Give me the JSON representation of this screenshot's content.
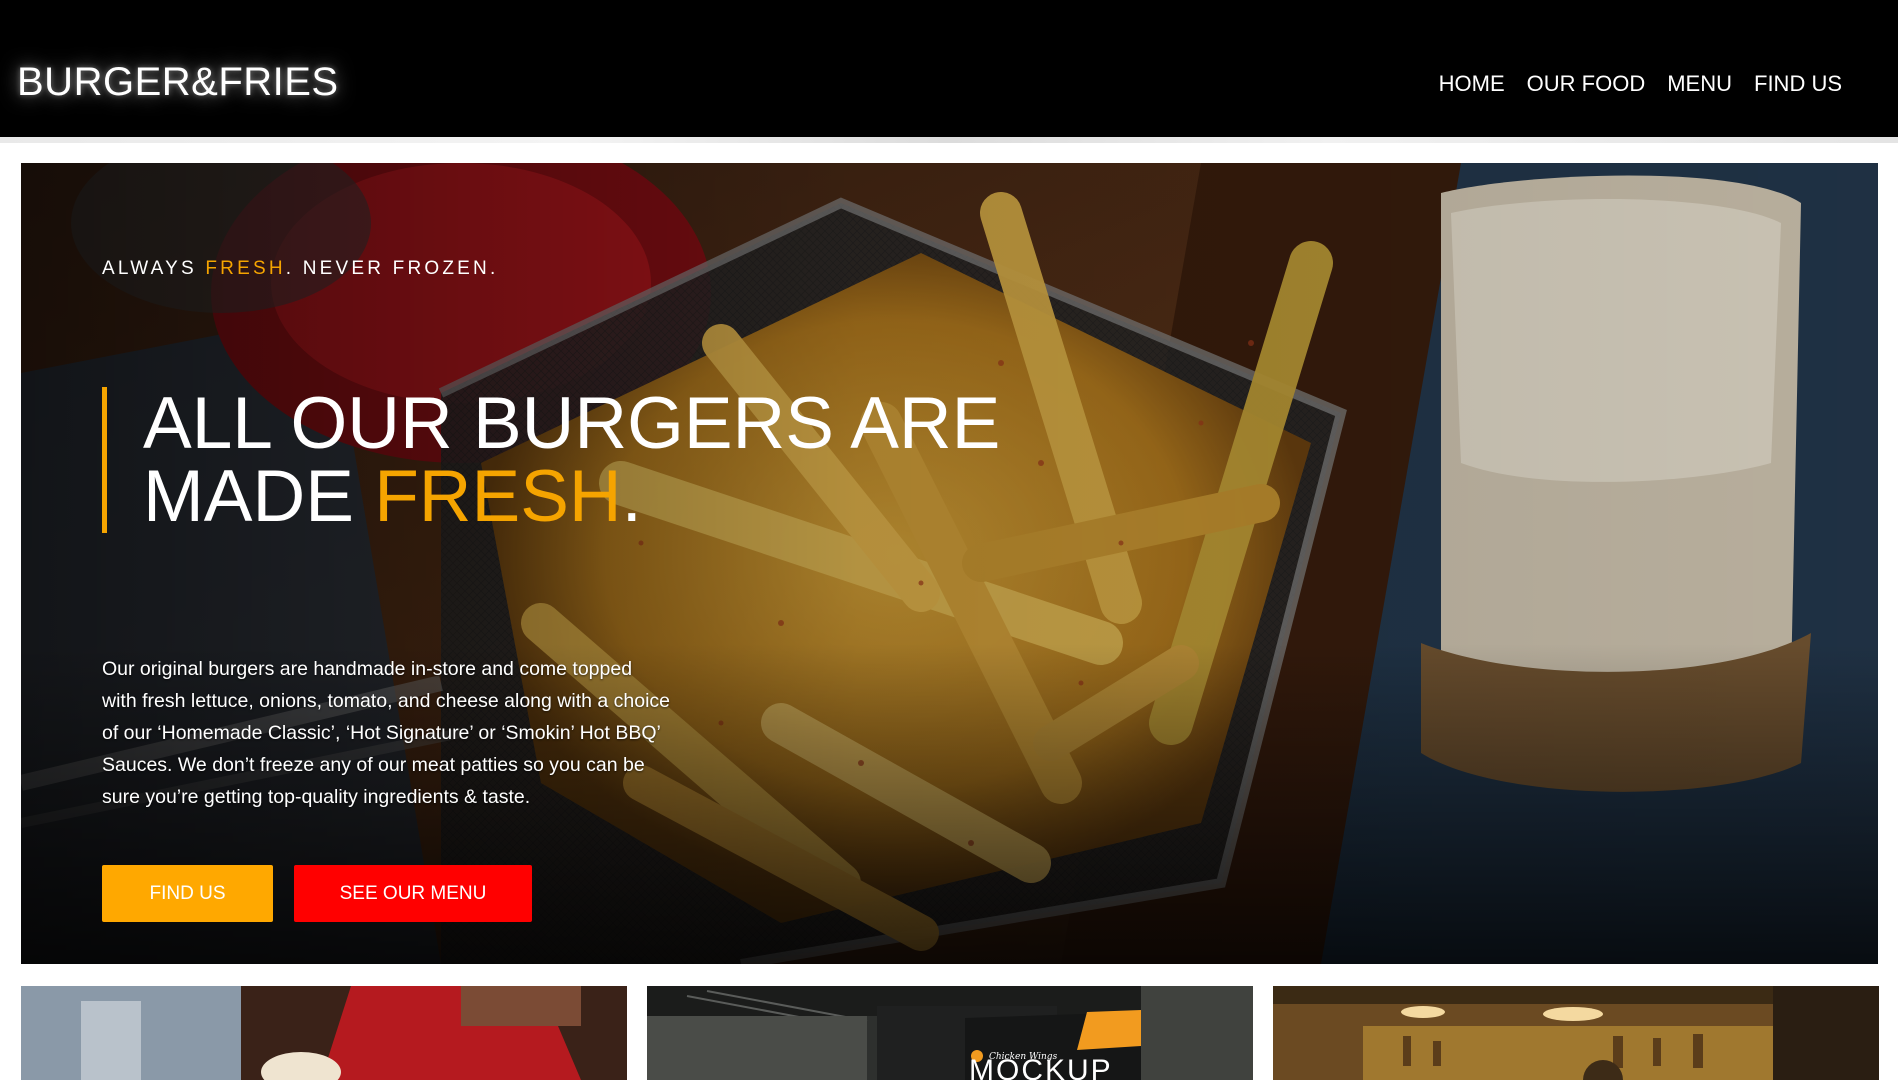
{
  "header": {
    "logo": "BURGER&FRIES",
    "nav": [
      "HOME",
      "OUR FOOD",
      "MENU",
      "FIND US"
    ]
  },
  "hero": {
    "tagline_pre": "ALWAYS ",
    "tagline_accent": "FRESH",
    "tagline_post": ". NEVER FROZEN.",
    "headline_line1": "ALL OUR BURGERS ARE",
    "headline_line2_pre": "MADE ",
    "headline_line2_accent": "FRESH",
    "headline_line2_post": ".",
    "description": "Our original burgers are handmade in-store and come topped with fresh lettuce, onions, tomato, and cheese along with a choice of our ‘Homemade Classic’, ‘Hot Signature’ or ‘Smokin’ Hot BBQ’ Sauces. We don’t freeze any of our meat patties so you can be sure you’re getting top-quality ingredients & taste.",
    "buttons": {
      "find_us": "FIND US",
      "see_menu": "SEE OUR MENU"
    },
    "image": "fries-in-basket-photo"
  },
  "cards": {
    "card1_image": "chef-photo",
    "card2_image": "storefront-sign-photo",
    "card2_sign_small": "Chicken Wings",
    "card2_sign_large": "MOCKUP",
    "card3_image": "restaurant-interior-photo"
  },
  "colors": {
    "accent": "#f5a400",
    "find_button": "#ffa800",
    "menu_button": "#ff0000",
    "header_bg": "#000000"
  }
}
